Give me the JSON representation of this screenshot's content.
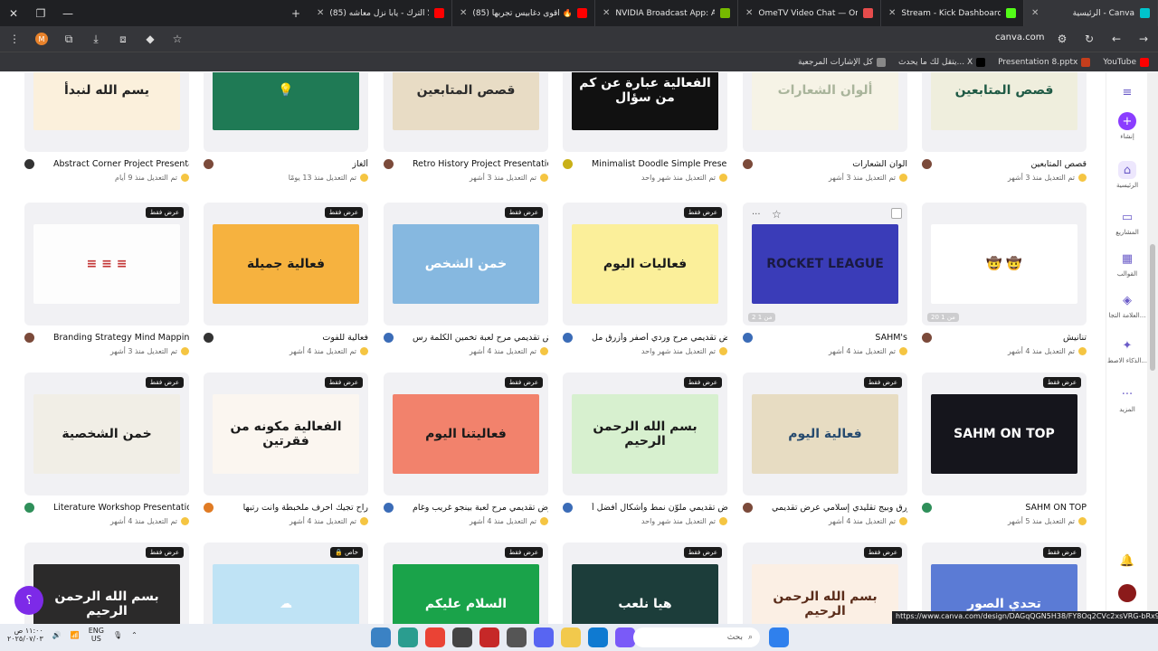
{
  "tabs": [
    {
      "title": "(85) حلا الترك - يابا نزل معاشه ...",
      "color": "#ff0000",
      "active": false
    },
    {
      "title": "(85) اقوى دغابيس تجربها 🔥",
      "color": "#ff0000",
      "active": false
    },
    {
      "title": "NVIDIA Broadcast App: AI-Pow...",
      "color": "#76b900",
      "active": false
    },
    {
      "title": "OmeTV Video Chat — Omegle...",
      "color": "#e64c4c",
      "active": false
    },
    {
      "title": "Stream - Kick Dashboard",
      "color": "#53fc18",
      "active": false
    },
    {
      "title": "الرئيسية - Canva",
      "color": "#00c4cc",
      "active": true
    }
  ],
  "window": {
    "close": "✕",
    "min": "—",
    "max": "❐",
    "new_tab": "+"
  },
  "address": {
    "url": "canva.com"
  },
  "bookmarks": [
    {
      "label": "YouTube",
      "color": "#ff0000"
    },
    {
      "label": "Presentation 8.pptx",
      "color": "#c43e1c"
    },
    {
      "label": "يتقل لك ما يحدث... X",
      "color": "#000000"
    },
    {
      "label": "كل الإشارات المرجعية",
      "color": "#888888"
    }
  ],
  "rail": [
    {
      "label": "",
      "icon": "≡"
    },
    {
      "label": "إنشاء",
      "icon": "+"
    },
    {
      "label": "الرئيسية",
      "icon": "⌂"
    },
    {
      "label": "المشاريع",
      "icon": "▭"
    },
    {
      "label": "القوالب",
      "icon": "▦"
    },
    {
      "label": "العلامة التجا...",
      "icon": "◈"
    },
    {
      "label": "الذكاء الاصط...",
      "icon": "✦"
    },
    {
      "label": "المزيد",
      "icon": "···"
    }
  ],
  "cards": [
    {
      "title": "قصص المتابعين",
      "sub": "تم التعديل منذ 3 أشهر",
      "bg": "#efeedd",
      "text": "قصص المتابعين",
      "tc": "#1f5a45",
      "badge": "",
      "av": "#7b4a3a"
    },
    {
      "title": "الوان الشعارات",
      "sub": "تم التعديل منذ 3 أشهر",
      "bg": "#f6f3e6",
      "text": "ألوان الشعارات",
      "tc": "#a9b49b",
      "badge": "",
      "av": "#7b4a3a"
    },
    {
      "title": "Minimalist Doodle Simple Presentation",
      "sub": "تم التعديل منذ شهر واحد",
      "bg": "#111111",
      "text": "الفعالية عبارة عن كم من سؤال",
      "tc": "#ffffff",
      "badge": "",
      "av": "#c9b017"
    },
    {
      "title": "Retro History Project Presentation",
      "sub": "تم التعديل منذ 3 أشهر",
      "bg": "#e8dcc5",
      "text": "قصص المتابعين",
      "tc": "#2b2b2b",
      "badge": "",
      "av": "#7b4a3a"
    },
    {
      "title": "ألغاز",
      "sub": "تم التعديل منذ 13 يومًا",
      "bg": "#1f7a55",
      "text": "💡",
      "tc": "#ffffff",
      "badge": "",
      "av": "#7b4a3a"
    },
    {
      "title": "Abstract Corner Project Presentation",
      "sub": "تم التعديل منذ 9 أيام",
      "bg": "#fbf0dc",
      "text": "يسم الله لنبدأ",
      "tc": "#222222",
      "badge": "",
      "av": "#333333"
    },
    {
      "title": "تنانيش",
      "sub": "تم التعديل منذ 4 أشهر",
      "bg": "#ffffff",
      "text": "🤠 🤠",
      "tc": "#222222",
      "badge": "",
      "av": "#7b4a3a"
    },
    {
      "title": "SAHM's",
      "sub": "تم التعديل منذ 4 أشهر",
      "bg": "#3a3cb8",
      "text": "ROCKET LEAGUE",
      "tc": "#1a1a40",
      "badge": "",
      "av": "#3b6cb7"
    },
    {
      "title": "عرض تقديمي مرح وردي أصفر وأزرق مل...",
      "sub": "تم التعديل منذ شهر واحد",
      "bg": "#fbef9a",
      "text": "فعاليات اليوم",
      "tc": "#1a1a1a",
      "badge": "عرض فقط",
      "av": "#3b6cb7"
    },
    {
      "title": "عرض تقديمي مرح لعبة تخمين الكلمة رس...",
      "sub": "تم التعديل منذ 4 أشهر",
      "bg": "#86b8e0",
      "text": "خمن الشخص",
      "tc": "#ffffff",
      "badge": "عرض فقط",
      "av": "#3b6cb7"
    },
    {
      "title": "فعالية للفوت",
      "sub": "تم التعديل منذ 4 أشهر",
      "bg": "#f6b23f",
      "text": "فعالية جميلة",
      "tc": "#1a1a1a",
      "badge": "عرض فقط",
      "av": "#333333"
    },
    {
      "title": "Branding Strategy Mind Mapping",
      "sub": "تم التعديل منذ 3 أشهر",
      "bg": "#fdfdfd",
      "text": "≡ ≡ ≡",
      "tc": "#c33333",
      "badge": "عرض فقط",
      "av": "#7b4a3a"
    },
    {
      "title": "SAHM ON TOP",
      "sub": "تم التعديل منذ 5 أشهر",
      "bg": "#15151c",
      "text": "SAHM ON TOP",
      "tc": "#ffffff",
      "badge": "عرض فقط",
      "av": "#2f8f5a"
    },
    {
      "title": "أزرق وبيج تقليدي إسلامي عرض تقديمي",
      "sub": "تم التعديل منذ 4 أشهر",
      "bg": "#e7dcc2",
      "text": "فعالية اليوم",
      "tc": "#264a6e",
      "badge": "عرض فقط",
      "av": "#7b4a3a"
    },
    {
      "title": "عرض تقديمي ملوّن نمط وأشكال أفضل أ...",
      "sub": "تم التعديل منذ شهر واحد",
      "bg": "#d7f0cf",
      "text": "بسم الله الرحمن الرحيم",
      "tc": "#1a1a1a",
      "badge": "عرض فقط",
      "av": "#3b6cb7"
    },
    {
      "title": "عرض تقديمي مرح لعبة بينجو غريب وغام...",
      "sub": "تم التعديل منذ 4 أشهر",
      "bg": "#f2826c",
      "text": "فعاليتنا اليوم",
      "tc": "#1a1a1a",
      "badge": "عرض فقط",
      "av": "#3b6cb7"
    },
    {
      "title": "راح تجيك احرف ملخبطة وانت رتبها",
      "sub": "تم التعديل منذ 4 أشهر",
      "bg": "#fbf6f0",
      "text": "الفعالية مكونه من فقرتين",
      "tc": "#1a1a1a",
      "badge": "عرض فقط",
      "av": "#e07b24"
    },
    {
      "title": "Literature Workshop Presentation",
      "sub": "تم التعديل منذ 4 أشهر",
      "bg": "#f1eee6",
      "text": "خمن الشخصية",
      "tc": "#1a1a1a",
      "badge": "عرض فقط",
      "av": "#2f8f5a"
    },
    {
      "title": "",
      "sub": "",
      "bg": "#5b7bd5",
      "text": "تحدي الصور",
      "tc": "#ffffff",
      "badge": "عرض فقط",
      "av": "#7b4a3a"
    },
    {
      "title": "",
      "sub": "",
      "bg": "#fbefe4",
      "text": "بسم الله الرحمن الرحيم",
      "tc": "#5a2c1a",
      "badge": "عرض فقط",
      "av": "#7b4a3a"
    },
    {
      "title": "",
      "sub": "",
      "bg": "#1c3d3a",
      "text": "هيا نلعب",
      "tc": "#ffffff",
      "badge": "عرض فقط",
      "av": "#7b4a3a"
    },
    {
      "title": "",
      "sub": "",
      "bg": "#1aa34a",
      "text": "السلام عليكم",
      "tc": "#ffffff",
      "badge": "عرض فقط",
      "av": "#7b4a3a"
    },
    {
      "title": "",
      "sub": "",
      "bg": "#bfe3f5",
      "text": "☁",
      "tc": "#ffffff",
      "badge": "🔒 خاص",
      "av": "#7b4a3a"
    },
    {
      "title": "",
      "sub": "",
      "bg": "#2b2a2a",
      "text": "بسم الله الرحمن الرحيم",
      "tc": "#ffffff",
      "badge": "عرض فقط",
      "av": "#7b4a3a"
    }
  ],
  "page_counts": {
    "c6": "20 من 1",
    "c7": "2 من 1"
  },
  "status_url": "https://www.canva.com/design/DAGqQGN5H38/FY8Oq2CVc2xsVRG-bRx9KQ/edit",
  "taskbar": {
    "search": "بحث",
    "lang": "ENG",
    "region": "US",
    "time": "١١:٠٠ ص",
    "date": "٢٠٢٥/٠٧/٠٣"
  },
  "fab": "؟"
}
